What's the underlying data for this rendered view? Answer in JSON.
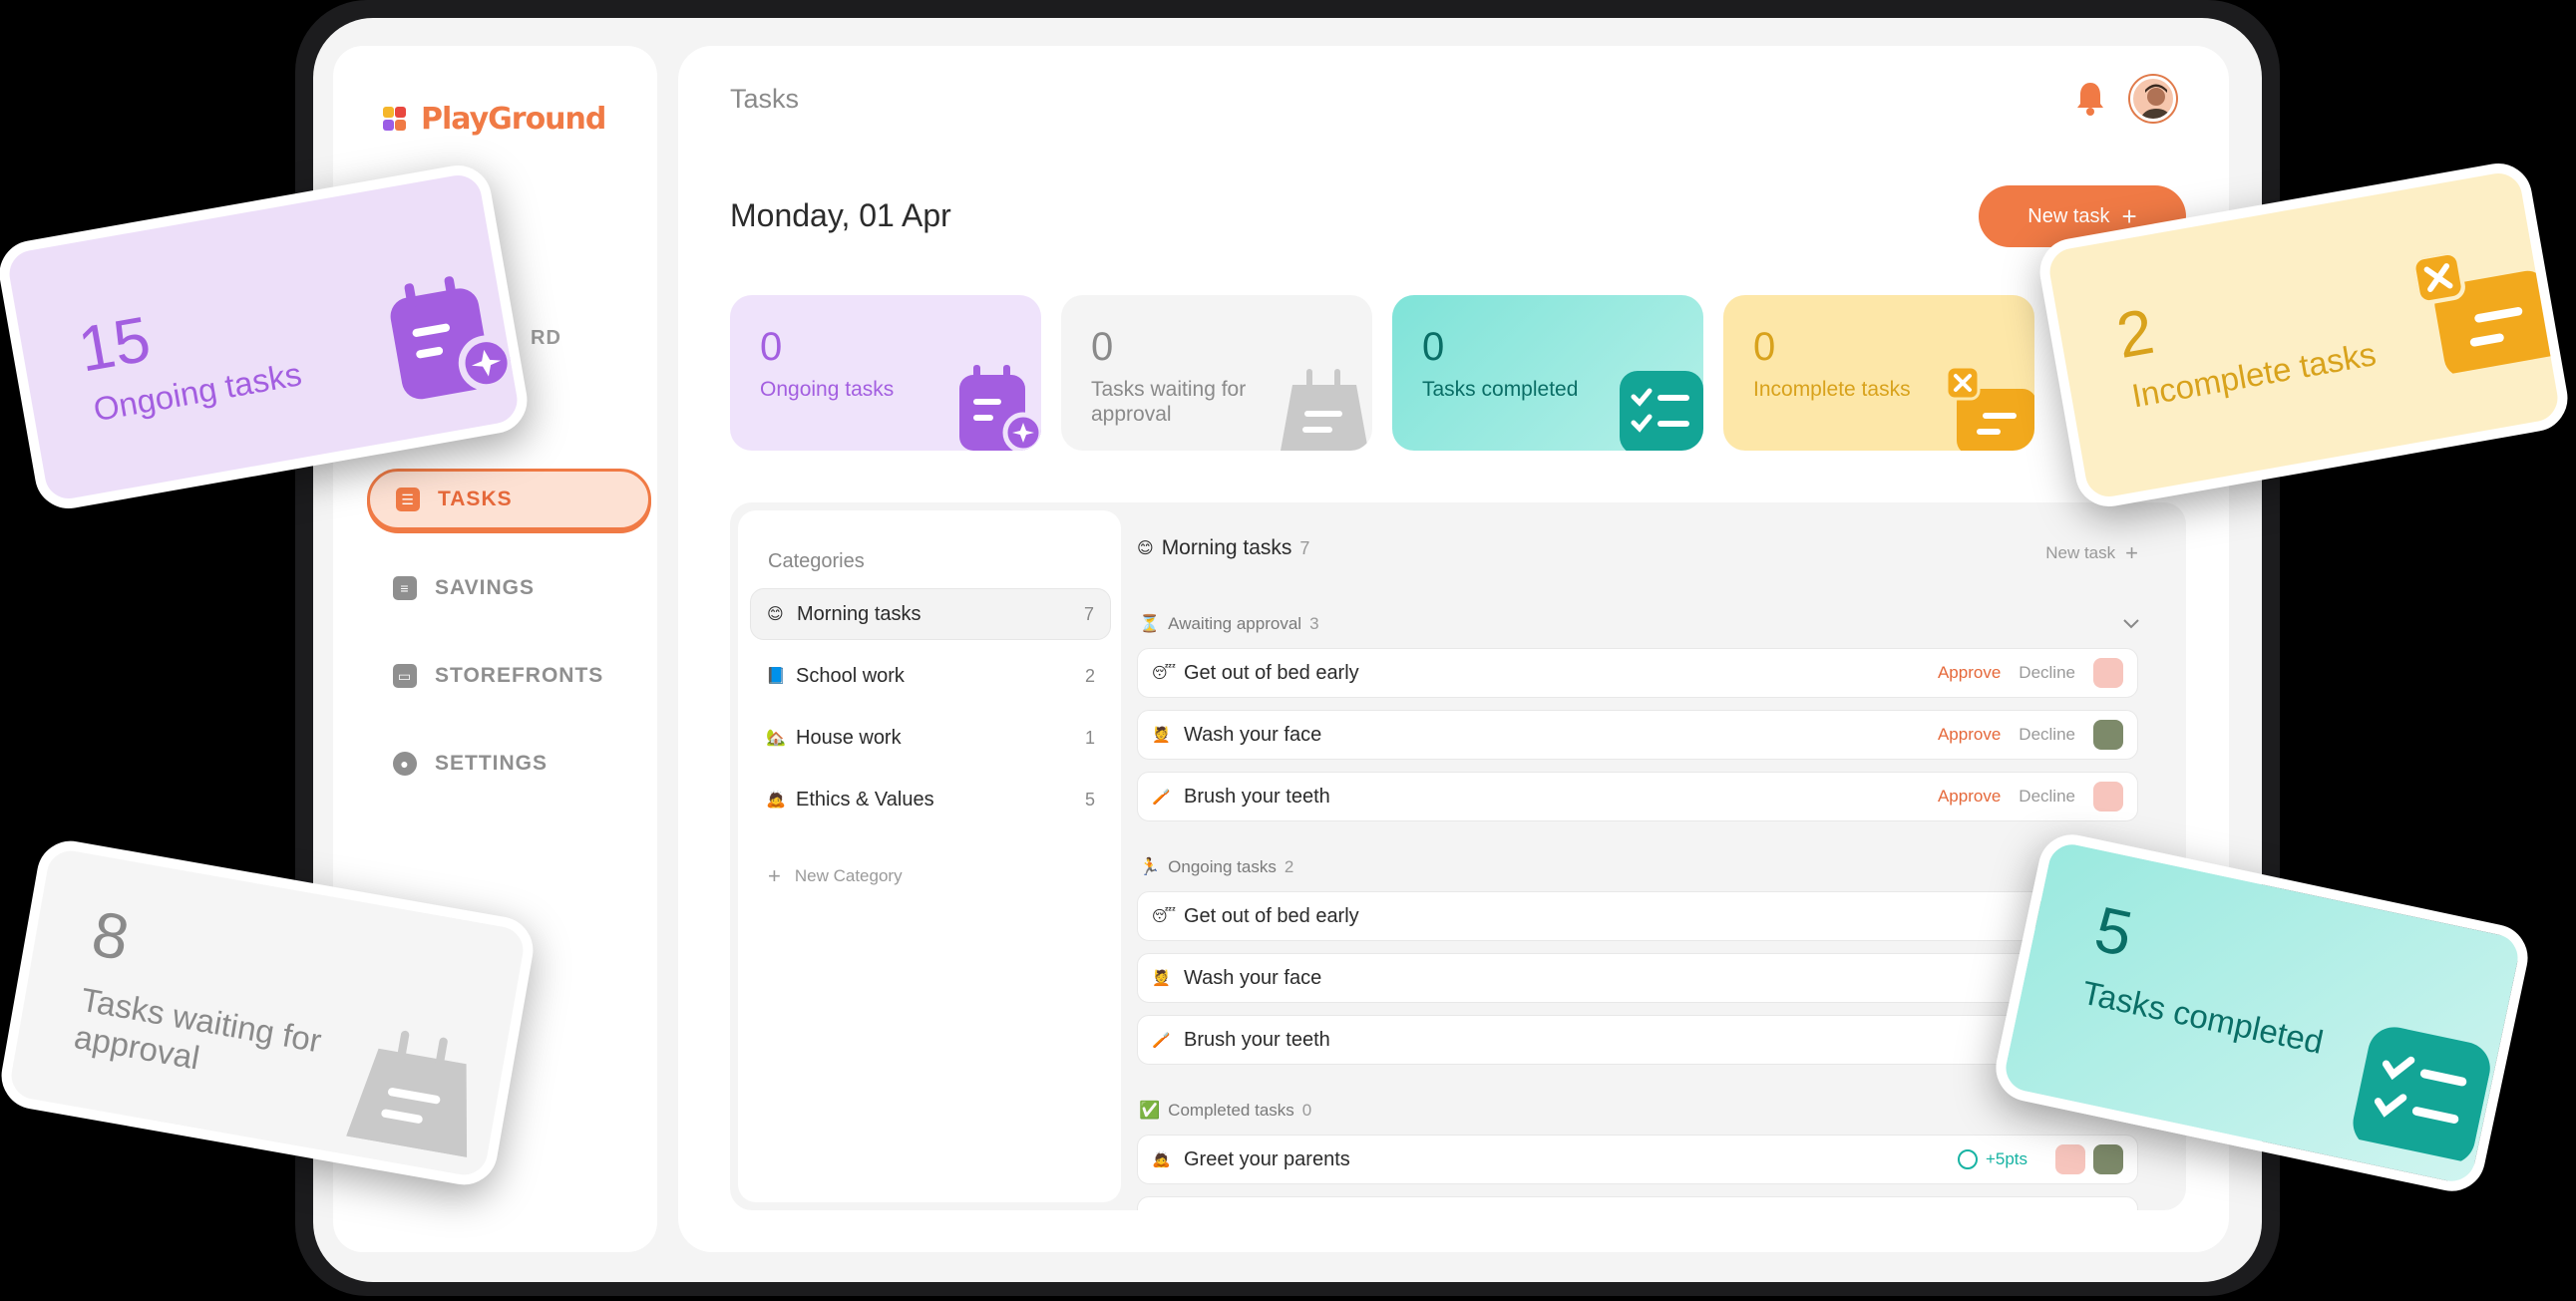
{
  "app": {
    "logo_text": "PlayGround"
  },
  "sidebar": {
    "peek_label": "RD",
    "items": [
      {
        "label": "TASKS",
        "icon": "tasks-icon",
        "active": true
      },
      {
        "label": "SAVINGS",
        "icon": "savings-icon"
      },
      {
        "label": "STOREFRONTS",
        "icon": "storefront-icon"
      },
      {
        "label": "SETTINGS",
        "icon": "settings-gear-icon"
      }
    ]
  },
  "header": {
    "title": "Tasks"
  },
  "main": {
    "date": "Monday, 01 Apr",
    "new_task_label": "New task",
    "stats": [
      {
        "value": "0",
        "label": "Ongoing tasks"
      },
      {
        "value": "0",
        "label": "Tasks waiting for approval"
      },
      {
        "value": "0",
        "label": "Tasks completed"
      },
      {
        "value": "0",
        "label": "Incomplete tasks"
      }
    ]
  },
  "categories": {
    "title": "Categories",
    "items": [
      {
        "emoji": "😊",
        "label": "Morning tasks",
        "count": "7"
      },
      {
        "emoji": "📘",
        "label": "School work",
        "count": "2"
      },
      {
        "emoji": "🏡",
        "label": "House work",
        "count": "1"
      },
      {
        "emoji": "🙇",
        "label": "Ethics & Values",
        "count": "5"
      }
    ],
    "new_label": "New Category"
  },
  "tasks": {
    "title": "Morning tasks",
    "title_count": "7",
    "new_task_label": "New task",
    "sections": [
      {
        "emoji": "⏳",
        "label": "Awaiting approval",
        "count": "3"
      },
      {
        "emoji": "🏃",
        "label": "Ongoing tasks",
        "count": "2"
      },
      {
        "emoji": "✅",
        "label": "Completed tasks",
        "count": "0"
      }
    ],
    "awaiting": [
      {
        "emoji": "😴",
        "label": "Get out of bed early",
        "approve": "Approve",
        "decline": "Decline"
      },
      {
        "emoji": "💆",
        "label": "Wash your face",
        "approve": "Approve",
        "decline": "Decline"
      },
      {
        "emoji": "🪥",
        "label": "Brush your teeth",
        "approve": "Approve",
        "decline": "Decline"
      }
    ],
    "ongoing": [
      {
        "emoji": "😴",
        "label": "Get out of bed early"
      },
      {
        "emoji": "💆",
        "label": "Wash your face"
      },
      {
        "emoji": "🪥",
        "label": "Brush your teeth"
      }
    ],
    "completed": [
      {
        "emoji": "🙇",
        "label": "Greet your parents",
        "points": "+5pts"
      }
    ]
  },
  "floating_cards": [
    {
      "value": "15",
      "label": "Ongoing tasks"
    },
    {
      "value": "8",
      "label": "Tasks waiting for approval"
    },
    {
      "value": "2",
      "label": "Incomplete tasks"
    },
    {
      "value": "5",
      "label": "Tasks completed"
    }
  ],
  "colors": {
    "accent": "#f07a45",
    "purple": "#a35ee0",
    "teal": "#0a8f84",
    "amber": "#d8a21c",
    "grey": "#8a8a8a"
  }
}
